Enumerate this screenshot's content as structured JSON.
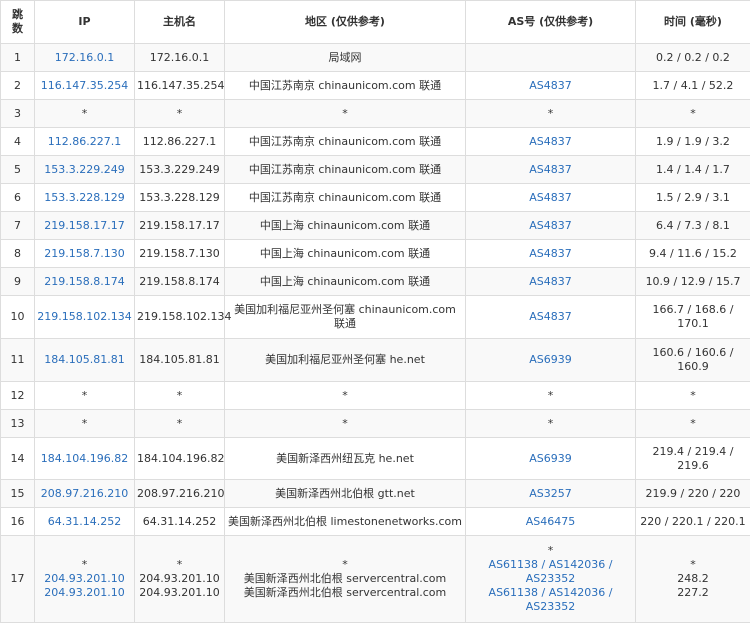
{
  "headers": {
    "hop": "跳数",
    "ip": "IP",
    "host": "主机名",
    "region": "地区 (仅供参考)",
    "as": "AS号 (仅供参考)",
    "time": "时间 (毫秒)"
  },
  "rows": [
    {
      "hop": "1",
      "ip": "172.16.0.1",
      "host": "172.16.0.1",
      "region": "局域网",
      "as": "",
      "time": "0.2 / 0.2 / 0.2"
    },
    {
      "hop": "2",
      "ip": "116.147.35.254",
      "host": "116.147.35.254",
      "region": "中国江苏南京 chinaunicom.com 联通",
      "as": "AS4837",
      "time": "1.7 / 4.1 / 52.2"
    },
    {
      "hop": "3",
      "ip": "*",
      "host": "*",
      "region": "*",
      "as": "*",
      "time": "*"
    },
    {
      "hop": "4",
      "ip": "112.86.227.1",
      "host": "112.86.227.1",
      "region": "中国江苏南京 chinaunicom.com 联通",
      "as": "AS4837",
      "time": "1.9 / 1.9 / 3.2"
    },
    {
      "hop": "5",
      "ip": "153.3.229.249",
      "host": "153.3.229.249",
      "region": "中国江苏南京 chinaunicom.com 联通",
      "as": "AS4837",
      "time": "1.4 / 1.4 / 1.7"
    },
    {
      "hop": "6",
      "ip": "153.3.228.129",
      "host": "153.3.228.129",
      "region": "中国江苏南京 chinaunicom.com 联通",
      "as": "AS4837",
      "time": "1.5 / 2.9 / 3.1"
    },
    {
      "hop": "7",
      "ip": "219.158.17.17",
      "host": "219.158.17.17",
      "region": "中国上海 chinaunicom.com 联通",
      "as": "AS4837",
      "time": "6.4 / 7.3 / 8.1"
    },
    {
      "hop": "8",
      "ip": "219.158.7.130",
      "host": "219.158.7.130",
      "region": "中国上海 chinaunicom.com 联通",
      "as": "AS4837",
      "time": "9.4 / 11.6 / 15.2"
    },
    {
      "hop": "9",
      "ip": "219.158.8.174",
      "host": "219.158.8.174",
      "region": "中国上海 chinaunicom.com 联通",
      "as": "AS4837",
      "time": "10.9 / 12.9 / 15.7"
    },
    {
      "hop": "10",
      "ip": "219.158.102.134",
      "host": "219.158.102.134",
      "region": "美国加利福尼亚州圣何塞 chinaunicom.com 联通",
      "as": "AS4837",
      "time": "166.7 / 168.6 / 170.1"
    },
    {
      "hop": "11",
      "ip": "184.105.81.81",
      "host": "184.105.81.81",
      "region": "美国加利福尼亚州圣何塞 he.net",
      "as": "AS6939",
      "time": "160.6 / 160.6 / 160.9"
    },
    {
      "hop": "12",
      "ip": "*",
      "host": "*",
      "region": "*",
      "as": "*",
      "time": "*"
    },
    {
      "hop": "13",
      "ip": "*",
      "host": "*",
      "region": "*",
      "as": "*",
      "time": "*"
    },
    {
      "hop": "14",
      "ip": "184.104.196.82",
      "host": "184.104.196.82",
      "region": "美国新泽西州纽瓦克 he.net",
      "as": "AS6939",
      "time": "219.4 / 219.4 / 219.6"
    },
    {
      "hop": "15",
      "ip": "208.97.216.210",
      "host": "208.97.216.210",
      "region": "美国新泽西州北伯根 gtt.net",
      "as": "AS3257",
      "time": "219.9 / 220 / 220"
    },
    {
      "hop": "16",
      "ip": "64.31.14.252",
      "host": "64.31.14.252",
      "region": "美国新泽西州北伯根 limestonenetworks.com",
      "as": "AS46475",
      "time": "220 / 220.1 / 220.1"
    }
  ],
  "row17": {
    "hop": "17",
    "ip": [
      "*",
      "204.93.201.10",
      "204.93.201.10"
    ],
    "host": [
      "*",
      "204.93.201.10",
      "204.93.201.10"
    ],
    "region": [
      "*",
      "美国新泽西州北伯根 servercentral.com",
      "美国新泽西州北伯根 servercentral.com"
    ],
    "as": [
      "*",
      "AS61138 / AS142036 /",
      "AS23352",
      "AS61138 / AS142036 /",
      "AS23352"
    ],
    "time": [
      "*",
      "248.2",
      "227.2"
    ]
  }
}
